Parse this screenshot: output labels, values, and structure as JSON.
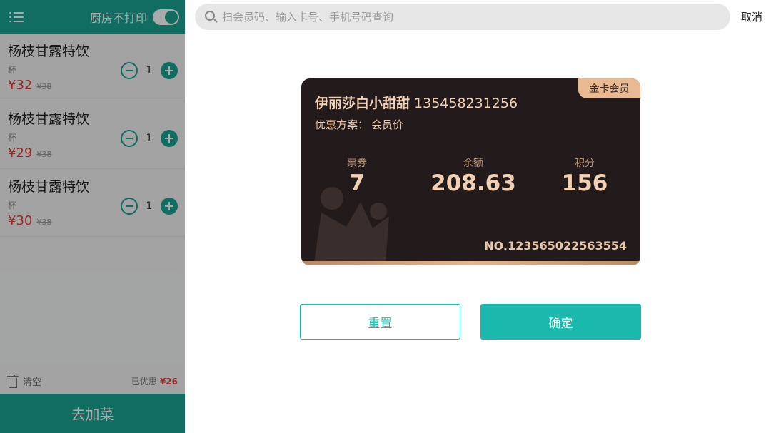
{
  "sidebar": {
    "kitchen_toggle_label": "厨房不打印",
    "kitchen_toggle_on": true,
    "items": [
      {
        "name": "杨枝甘露特饮",
        "unit": "杯",
        "price": "¥32",
        "original_price": "¥38",
        "qty": "1"
      },
      {
        "name": "杨枝甘露特饮",
        "unit": "杯",
        "price": "¥29",
        "original_price": "¥38",
        "qty": "1"
      },
      {
        "name": "杨枝甘露特饮",
        "unit": "杯",
        "price": "¥30",
        "original_price": "¥38",
        "qty": "1"
      }
    ],
    "clear_label": "清空",
    "discount_label": "已优惠",
    "discount_amount": "¥26",
    "add_dish_label": "去加菜"
  },
  "search": {
    "placeholder": "扫会员码、输入卡号、手机号码查询",
    "cancel_label": "取消"
  },
  "card": {
    "badge": "金卡会员",
    "member_name": "伊丽莎白小甜甜",
    "phone": "135458231256",
    "plan_label": "优惠方案：",
    "plan_value": "会员价",
    "stats": [
      {
        "label": "票券",
        "value": "7"
      },
      {
        "label": "余额",
        "value": "208.63"
      },
      {
        "label": "积分",
        "value": "156"
      }
    ],
    "card_number": "NO.123565022563554"
  },
  "buttons": {
    "reset": "重置",
    "confirm": "确定"
  },
  "colors": {
    "accent": "#1aa391",
    "confirm": "#1ab8ad",
    "card_bg": "#231a1b",
    "gold": "#e9b991",
    "price_red": "#e03b3b"
  }
}
